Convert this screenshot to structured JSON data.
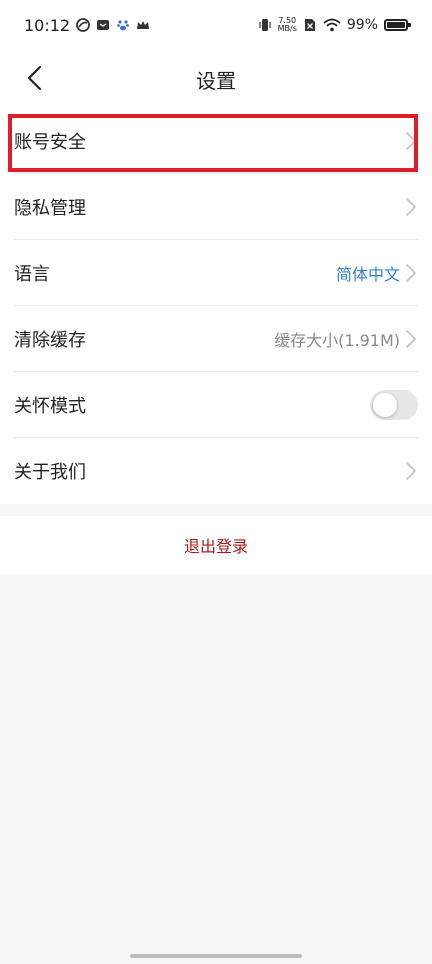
{
  "status_bar": {
    "time": "10:12",
    "net_speed_value": "7.50",
    "net_speed_unit": "MB/s",
    "battery_percent": "99%",
    "battery_level": 0.99,
    "icons": [
      "app-icon-swirl",
      "message-icon",
      "baidu-paw-icon",
      "crown-icon",
      "vibrate-icon",
      "sim-off-icon",
      "wifi-icon",
      "battery-icon"
    ]
  },
  "nav": {
    "title": "设置",
    "back_icon": "chevron-left-icon"
  },
  "settings": {
    "items": [
      {
        "label": "账号安全",
        "value": "",
        "control": "chevron"
      },
      {
        "label": "隐私管理",
        "value": "",
        "control": "chevron"
      },
      {
        "label": "语言",
        "value": "简体中文",
        "control": "chevron"
      },
      {
        "label": "清除缓存",
        "value": "缓存大小(1.91M)",
        "control": "chevron"
      },
      {
        "label": "关怀模式",
        "value": "",
        "control": "toggle",
        "toggle_on": false
      },
      {
        "label": "关于我们",
        "value": "",
        "control": "chevron"
      }
    ]
  },
  "logout": {
    "label": "退出登录",
    "color": "#b01818"
  },
  "colors": {
    "accent_blue": "#2f7fd8",
    "highlight_red": "#e01c2a"
  }
}
